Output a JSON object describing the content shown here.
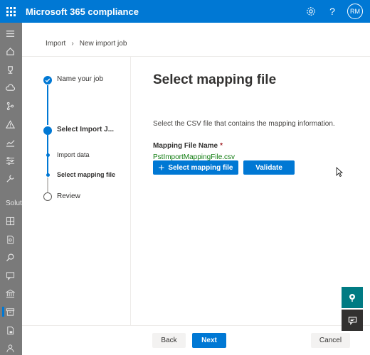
{
  "app": {
    "title": "Microsoft 365 compliance",
    "avatar_initials": "RM"
  },
  "topbar_icons": [
    "gear-icon",
    "help-icon"
  ],
  "nav": {
    "section_label": "Solut",
    "icons": [
      "hamburger-icon",
      "home-icon",
      "trophy-icon",
      "cloud-icon",
      "workflow-icon",
      "alert-icon",
      "chart-icon",
      "filters-icon",
      "wrench-icon",
      "catalog-icon",
      "document-search-icon",
      "search-icon",
      "chat-icon",
      "bank-icon",
      "archive-icon",
      "lock-doc-icon",
      "person-icon"
    ],
    "active_icon": "archive-icon"
  },
  "breadcrumb": {
    "items": [
      "Import",
      "New import job"
    ]
  },
  "steps": [
    {
      "label": "Name your job",
      "state": "completed"
    },
    {
      "label": "Select Import J...",
      "state": "current"
    },
    {
      "label": "Import data",
      "state": "substep-done"
    },
    {
      "label": "Select mapping file",
      "state": "substep-current"
    },
    {
      "label": "Review",
      "state": "pending"
    }
  ],
  "main": {
    "title": "Select mapping file",
    "description": "Select the CSV file that contains the mapping information.",
    "field_label": "Mapping File Name",
    "required_marker": "*",
    "file_name": "PstImportMappingFile.csv",
    "select_button": "Select mapping file",
    "validate_button": "Validate"
  },
  "footer": {
    "back": "Back",
    "next": "Next",
    "cancel": "Cancel"
  },
  "colors": {
    "accent": "#0078d4",
    "file_name": "#107c10",
    "teal_float": "#007b83",
    "required": "#a4262c"
  }
}
